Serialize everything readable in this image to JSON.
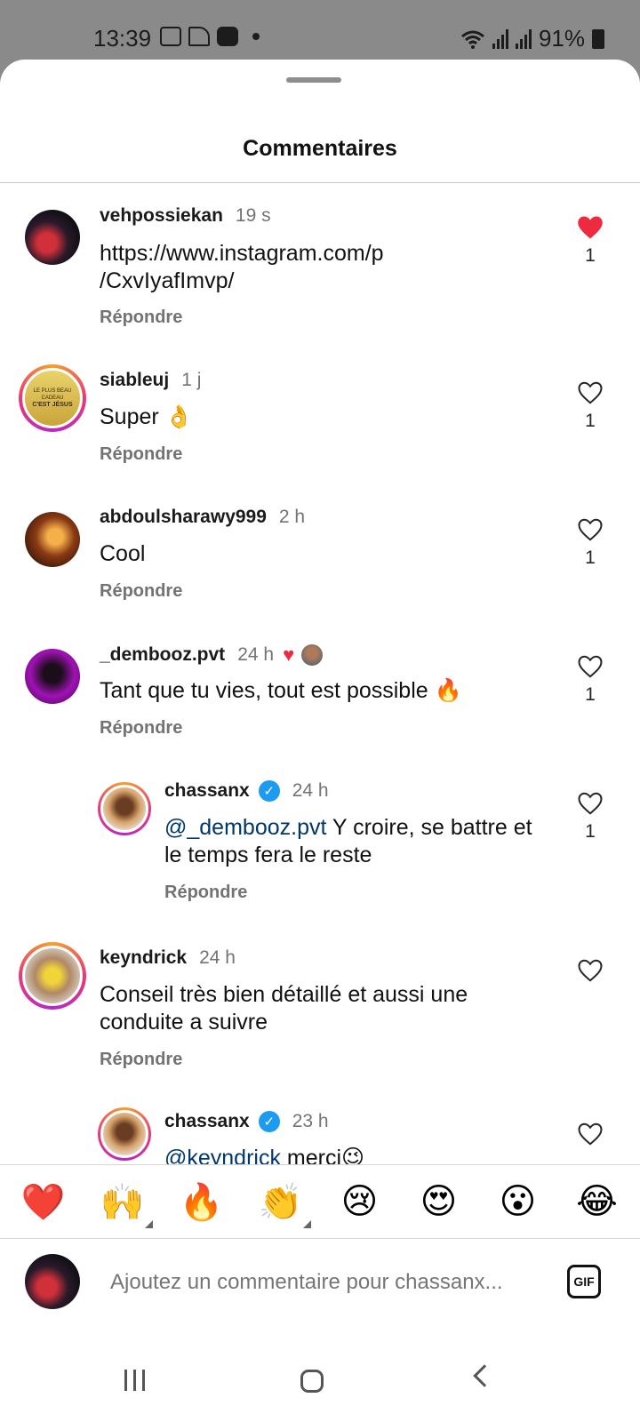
{
  "status": {
    "time": "13:39",
    "battery": "91%",
    "icons_left": [
      "gallery-icon",
      "telegram-icon",
      "app-icon"
    ],
    "icons_right": [
      "wifi-icon",
      "signal-icon",
      "signal-icon",
      "battery-icon"
    ]
  },
  "sheet": {
    "title": "Commentaires"
  },
  "comments": [
    {
      "username": "vehpossiekan",
      "time": "19 s",
      "text": "https://www.instagram.com/p\n/CxvIyafImvp/",
      "reply": "Répondre",
      "liked": true,
      "likes": "1",
      "avatar_ring": false
    },
    {
      "username": "siableuj",
      "time": "1 j",
      "text": "Super 👌",
      "reply": "Répondre",
      "liked": false,
      "likes": "1",
      "avatar_ring": true,
      "avatar_text": [
        "LE PLUS BEAU CADEAU",
        "C'EST JÉSUS"
      ]
    },
    {
      "username": "abdoulsharawy999",
      "time": "2 h",
      "text": "Cool",
      "reply": "Répondre",
      "liked": false,
      "likes": "1",
      "avatar_ring": false
    },
    {
      "username": "_dembooz.pvt",
      "time": "24 h",
      "text": "Tant que tu vies, tout est possible 🔥",
      "reply": "Répondre",
      "liked": false,
      "likes": "1",
      "liked_by_author": true,
      "avatar_ring": false
    },
    {
      "username": "chassanx",
      "verified": true,
      "time": "24 h",
      "mention": "@_dembooz.pvt",
      "text": " Y croire, se battre et\nle temps fera le reste",
      "reply": "Répondre",
      "liked": false,
      "likes": "1",
      "is_reply": true,
      "avatar_ring": true
    },
    {
      "username": "keyndrick",
      "time": "24 h",
      "text": "Conseil très bien détaillé et aussi une\nconduite a suivre",
      "reply": "Répondre",
      "liked": false,
      "likes": "",
      "avatar_ring": true
    },
    {
      "username": "chassanx",
      "verified": true,
      "time": "23 h",
      "mention": "@keyndrick",
      "text": " merci😉",
      "liked": false,
      "likes": "",
      "is_reply": true,
      "avatar_ring": true
    }
  ],
  "emoji_bar": [
    "❤️",
    "🙌",
    "🔥",
    "👏",
    "😢",
    "😍",
    "😮",
    "😂"
  ],
  "compose": {
    "placeholder": "Ajoutez un commentaire pour chassanx...",
    "gif_label": "GIF"
  },
  "colors": {
    "like_red": "#ed2a3f",
    "mention_blue": "#00376b",
    "verified_blue": "#1d9bf0",
    "muted": "#737373"
  }
}
